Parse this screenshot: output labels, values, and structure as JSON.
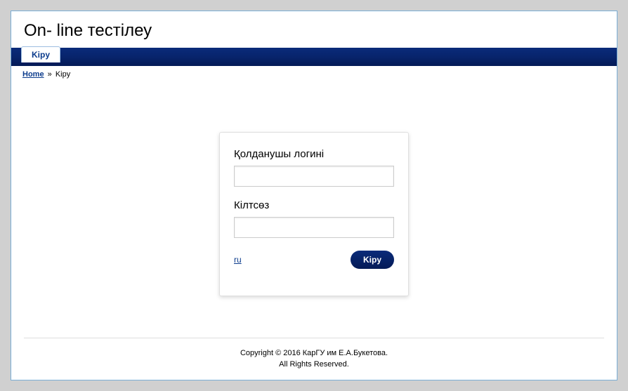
{
  "header": {
    "title": "On- line тестілеу"
  },
  "nav": {
    "tab_label": "Kipy"
  },
  "breadcrumb": {
    "home_label": "Home",
    "separator": "»",
    "current": "Kipy"
  },
  "login": {
    "username_label": "Қолданушы логині",
    "username_value": "",
    "password_label": "Кілтсөз",
    "password_value": "",
    "lang_link": "ru",
    "submit_label": "Kipy"
  },
  "footer": {
    "line1": "Copyright © 2016 КарГУ им Е.А.Букетова.",
    "line2": "All Rights Reserved."
  }
}
